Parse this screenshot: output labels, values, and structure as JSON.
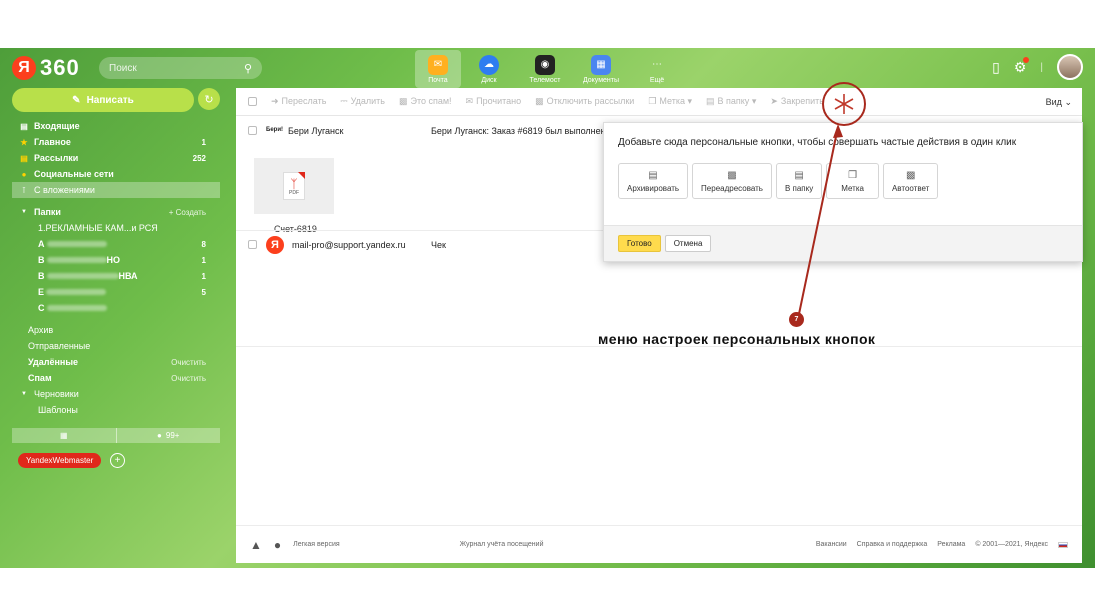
{
  "colors": {
    "accent": "#b8e04a",
    "brand_red": "#fc3f1d",
    "annotation": "#a8291d",
    "ok_button": "#ffdb4d"
  },
  "header": {
    "logo_ya": "Я",
    "logo_360": "360",
    "search_placeholder": "Поиск",
    "services": [
      {
        "label": "Почта",
        "icon": "mail-envelope-icon",
        "color": "#ffb020"
      },
      {
        "label": "Диск",
        "icon": "cloud-disk-icon",
        "color": "#2f7df0"
      },
      {
        "label": "Телемост",
        "icon": "video-camera-icon",
        "color": "#222222"
      },
      {
        "label": "Документы",
        "icon": "documents-icon",
        "color": "#4a86f0"
      },
      {
        "label": "Ещё",
        "icon": "more-dots-icon",
        "color": "transparent"
      }
    ]
  },
  "sidebar": {
    "compose_label": "Написать",
    "folders": [
      {
        "label": "Входящие",
        "icon": "inbox-icon",
        "count": ""
      },
      {
        "label": "Главное",
        "icon": "star-icon",
        "count": "1"
      },
      {
        "label": "Рассылки",
        "icon": "newsletters-icon",
        "count": "252"
      },
      {
        "label": "Социальные сети",
        "icon": "social-icon",
        "count": ""
      },
      {
        "label": "С вложениями",
        "icon": "paperclip-icon",
        "count": ""
      }
    ],
    "folders_header": "Папки",
    "create_label": "+ Создать",
    "subfolders": [
      {
        "label": "1.РЕКЛАМНЫЕ КАМ...и РСЯ",
        "count": ""
      },
      {
        "label": "А",
        "count": "8"
      },
      {
        "label": "В",
        "suffix": "НО",
        "count": "1"
      },
      {
        "label": "В",
        "suffix": "НВА",
        "count": "1"
      },
      {
        "label": "Е",
        "count": "5"
      },
      {
        "label": "С",
        "count": ""
      }
    ],
    "system": [
      {
        "label": "Архив",
        "action": ""
      },
      {
        "label": "Отправленные",
        "action": ""
      },
      {
        "label": "Удалённые",
        "action": "Очистить"
      },
      {
        "label": "Спам",
        "action": "Очистить"
      }
    ],
    "drafts_label": "Черновики",
    "templates_label": "Шаблоны",
    "unread_count": "99+",
    "label_tag": "YandexWebmaster"
  },
  "toolbar": {
    "items": [
      {
        "label": "Переслать",
        "icon": "forward-icon"
      },
      {
        "label": "Удалить",
        "icon": "trash-icon"
      },
      {
        "label": "Это спам!",
        "icon": "spam-icon"
      },
      {
        "label": "Прочитано",
        "icon": "read-icon"
      },
      {
        "label": "Отключить рассылки",
        "icon": "unsubscribe-icon"
      },
      {
        "label": "Метка",
        "icon": "label-icon"
      },
      {
        "label": "В папку",
        "icon": "folder-icon"
      },
      {
        "label": "Закрепить",
        "icon": "pin-icon"
      }
    ],
    "view_label": "Вид"
  },
  "messages": [
    {
      "sender_logo": "Бери!",
      "sender": "Бери Луганск",
      "subject": "Бери Луганск: Заказ #6819 был выполнен",
      "attachment_name": "Счет-6819",
      "attachment_ext": "PDF"
    },
    {
      "sender_logo": "Я",
      "sender": "mail-pro@support.yandex.ru",
      "subject": "Чек"
    }
  ],
  "popup": {
    "title": "Добавьте сюда персональные кнопки, чтобы совершать частые действия в один клик",
    "buttons": [
      {
        "label": "Архивировать",
        "icon": "archive-icon"
      },
      {
        "label": "Переадресовать",
        "icon": "redirect-icon"
      },
      {
        "label": "В папку",
        "icon": "folder-icon"
      },
      {
        "label": "Метка",
        "icon": "label-icon"
      },
      {
        "label": "Автоответ",
        "icon": "autoreply-icon"
      }
    ],
    "ok_label": "Готово",
    "cancel_label": "Отмена"
  },
  "footer": {
    "light_version": "Легкая версия",
    "visit_log": "Журнал учёта посещений",
    "jobs": "Вакансии",
    "help": "Справка и поддержка",
    "ads": "Реклама",
    "copyright": "© 2001—2021, Яндекс"
  },
  "annotation": {
    "badge": "7",
    "text": "меню настроек персональных кнопок"
  }
}
